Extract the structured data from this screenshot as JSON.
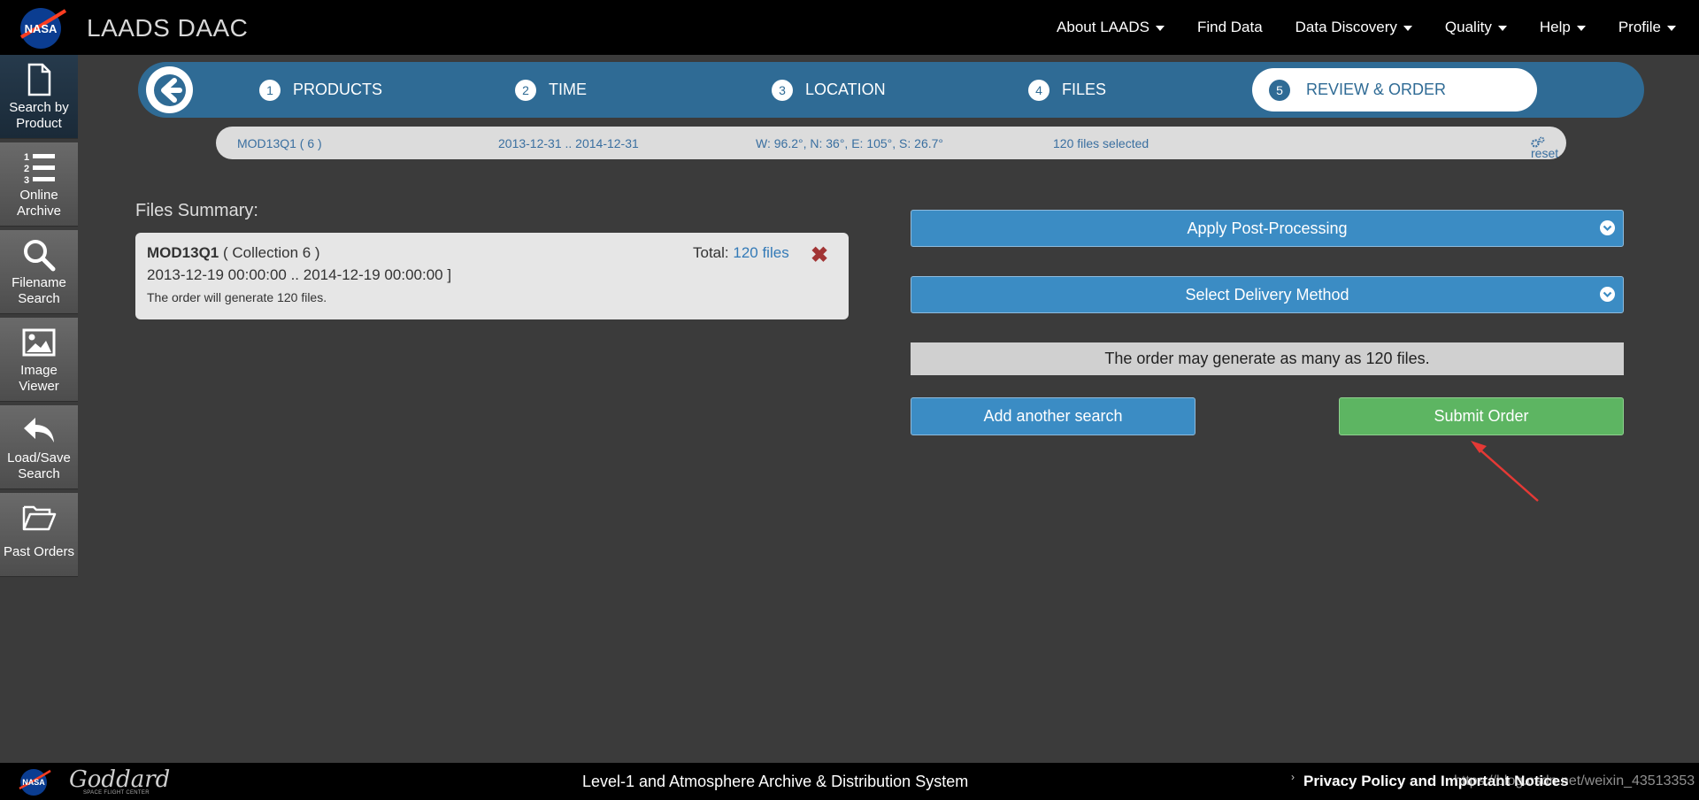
{
  "header": {
    "app_title": "LAADS DAAC",
    "nav": [
      {
        "label": "About LAADS",
        "has_caret": true
      },
      {
        "label": "Find Data",
        "has_caret": false
      },
      {
        "label": "Data Discovery",
        "has_caret": true
      },
      {
        "label": "Quality",
        "has_caret": true
      },
      {
        "label": "Help",
        "has_caret": true
      },
      {
        "label": "Profile",
        "has_caret": true
      }
    ]
  },
  "sidebar": {
    "items": [
      {
        "label": "Search by Product",
        "icon": "document-icon",
        "active": true
      },
      {
        "label": "Online Archive",
        "icon": "numbered-list-icon",
        "active": false
      },
      {
        "label": "Filename Search",
        "icon": "search-icon",
        "active": false
      },
      {
        "label": "Image Viewer",
        "icon": "image-icon",
        "active": false
      },
      {
        "label": "Load/Save Search",
        "icon": "reply-icon",
        "active": false
      },
      {
        "label": "Past Orders",
        "icon": "folder-open-icon",
        "active": false
      }
    ]
  },
  "steps": [
    {
      "num": "1",
      "label": "PRODUCTS"
    },
    {
      "num": "2",
      "label": "TIME"
    },
    {
      "num": "3",
      "label": "LOCATION"
    },
    {
      "num": "4",
      "label": "FILES"
    },
    {
      "num": "5",
      "label": "REVIEW & ORDER",
      "active": true
    }
  ],
  "criteria": {
    "product": "MOD13Q1 ( 6 )",
    "time_range": "2013-12-31 .. 2014-12-31",
    "location": "W: 96.2°, N: 36°, E: 105°, S: 26.7°",
    "files": "120 files selected",
    "reset_label": "reset"
  },
  "files_summary": {
    "heading": "Files Summary:",
    "product_name": "MOD13Q1",
    "collection": "( Collection 6 )",
    "dates": "2013-12-19 00:00:00 .. 2014-12-19 00:00:00 ]",
    "note": "The order will generate 120 files.",
    "total_label": "Total:",
    "total_link": "120 files",
    "remove_symbol": "✖"
  },
  "order": {
    "post_processing_label": "Apply Post-Processing",
    "delivery_label": "Select Delivery Method",
    "notice": "The order may generate as many as 120 files.",
    "add_search_label": "Add another search",
    "submit_label": "Submit Order"
  },
  "footer": {
    "goddard": "Goddard",
    "goddard_sub": "SPACE FLIGHT CENTER",
    "system_name": "Level-1 and Atmosphere Archive & Distribution System",
    "privacy_label": "Privacy Policy and Important Notices",
    "watermark": "https://blog.csdn.net/weixin_43513353"
  },
  "colors": {
    "steps_bar": "#2f6b95",
    "primary_button": "#3b8cc4",
    "submit_button": "#5db562",
    "annotation_arrow": "#e53935"
  }
}
